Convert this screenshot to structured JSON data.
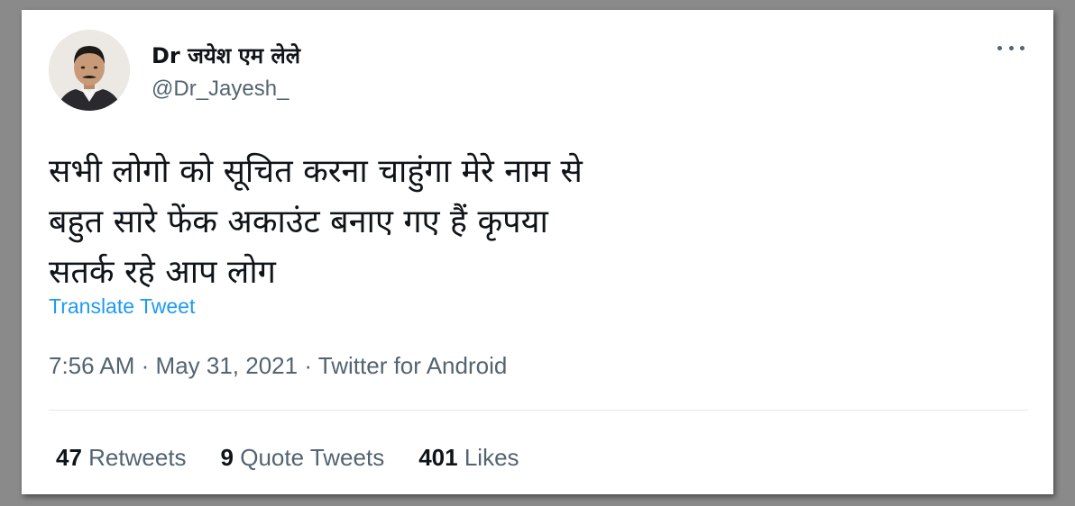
{
  "author": {
    "display_name": "Dr जयेश एम लेले",
    "handle": "@Dr_Jayesh_"
  },
  "tweet": {
    "lines": [
      "सभी लोगो को सूचित करना चाहुंगा मेरे नाम से",
      "बहुत सारे फेंक अकाउंट बनाए गए हैं कृपया",
      "सतर्क रहे आप लोग"
    ],
    "translate_label": "Translate Tweet"
  },
  "meta": {
    "time": "7:56 AM",
    "separator": "·",
    "date": "May 31, 2021",
    "source": "Twitter for Android"
  },
  "stats": {
    "retweets_count": "47",
    "retweets_label": "Retweets",
    "quotes_count": "9",
    "quotes_label": "Quote Tweets",
    "likes_count": "401",
    "likes_label": "Likes"
  },
  "icons": {
    "more": "more-horizontal-icon"
  },
  "colors": {
    "link": "#1d9bf0",
    "secondary_text": "#536471",
    "primary_text": "#0f1419"
  }
}
